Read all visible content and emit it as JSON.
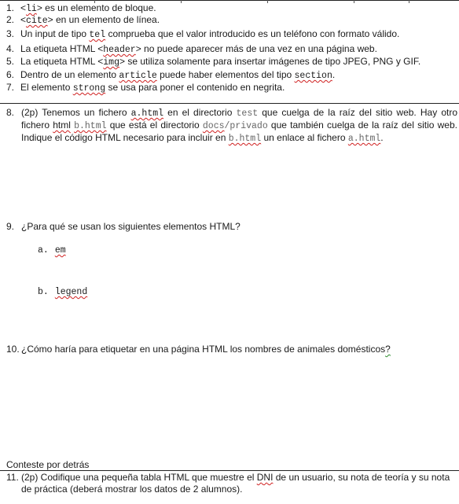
{
  "list": [
    {
      "num": "1.",
      "a": "<",
      "b": "li",
      "c": "> es un elemento de bloque."
    },
    {
      "num": "2.",
      "a": "<",
      "b": "cite",
      "c": "> en un elemento de línea."
    },
    {
      "num": "3.",
      "a": "Un input de tipo ",
      "b": "tel",
      "c": " comprueba que el valor introducido es un teléfono con formato válido."
    },
    {
      "num": "4.",
      "a": "La etiqueta HTML <",
      "b": "header",
      "c": "> no puede aparecer más de una vez en una página web."
    },
    {
      "num": "5.",
      "a": "La etiqueta HTML <",
      "b": "img",
      "c": "> se utiliza solamente para insertar imágenes de tipo JPEG, PNG y GIF."
    },
    {
      "num": "6.",
      "a": "Dentro de un elemento ",
      "b": "article",
      "c": " puede haber elementos del tipo ",
      "d": "section",
      "e": "."
    },
    {
      "num": "7.",
      "a": "El elemento ",
      "b": "strong",
      "c": " se usa para poner el contenido en negrita."
    }
  ],
  "q8": {
    "num": "8.",
    "p1": "(2p) Tenemos un fichero ",
    "f1": "a.html",
    "p2": " en el directorio ",
    "d1": "test",
    "p3": " que cuelga de la raíz del sitio web. Hay otro fichero ",
    "w1": "html",
    "p4": " ",
    "f2": "b.html",
    "p5": " que está el directorio ",
    "d2a": "docs",
    "d2b": "/privado",
    "p6": " que también cuelga de la raíz del sitio web. Indique el código HTML necesario para incluir en ",
    "f3": "b.html",
    "p7": "  un enlace al fichero ",
    "f4": "a.html",
    "p8": "."
  },
  "q9": {
    "num": "9.",
    "text": "¿Para qué se usan los siguientes elementos HTML?",
    "a_letter": "a.",
    "a_term": "em",
    "b_letter": "b.",
    "b_term": "legend"
  },
  "q10": {
    "num": "10.",
    "text": "¿Cómo haría para etiquetar en una página HTML los nombres de animales domésticos",
    "end": "?"
  },
  "note": "Conteste por detrás",
  "q11": {
    "num": "11.",
    "p1": "(2p) Codifique una pequeña tabla HTML que muestre el ",
    "dni": "DNI",
    "p2": " de un usuario, su nota de teoría y su nota de práctica (deberá mostrar los datos de 2 alumnos)."
  }
}
